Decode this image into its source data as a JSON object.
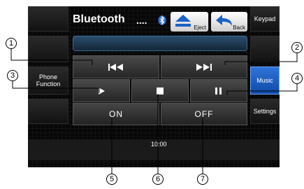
{
  "title": "Bluetooth",
  "title_suffix": "....",
  "icons": {
    "bluetooth": "bluetooth-icon",
    "eject": "eject-icon",
    "back": "back-arrow-icon"
  },
  "header_buttons": {
    "eject_label": "Eject",
    "back_label": "Back"
  },
  "left_tabs": {
    "phone_function": "Phone Function"
  },
  "right_tabs": {
    "keypad": "Keypad",
    "music": "Music",
    "settings": "Settings"
  },
  "controls": {
    "prev": "prev-track-icon",
    "next": "next-track-icon",
    "play": "play-icon",
    "stop": "stop-icon",
    "pause": "pause-icon",
    "on_label": "ON",
    "off_label": "OFF"
  },
  "clock": "10:00",
  "callouts": [
    "1",
    "2",
    "3",
    "4",
    "5",
    "6",
    "7"
  ],
  "colors": {
    "active_tab": "#2f74d8",
    "screen_bg": "#070707",
    "bluetooth": "#2f74d8"
  }
}
